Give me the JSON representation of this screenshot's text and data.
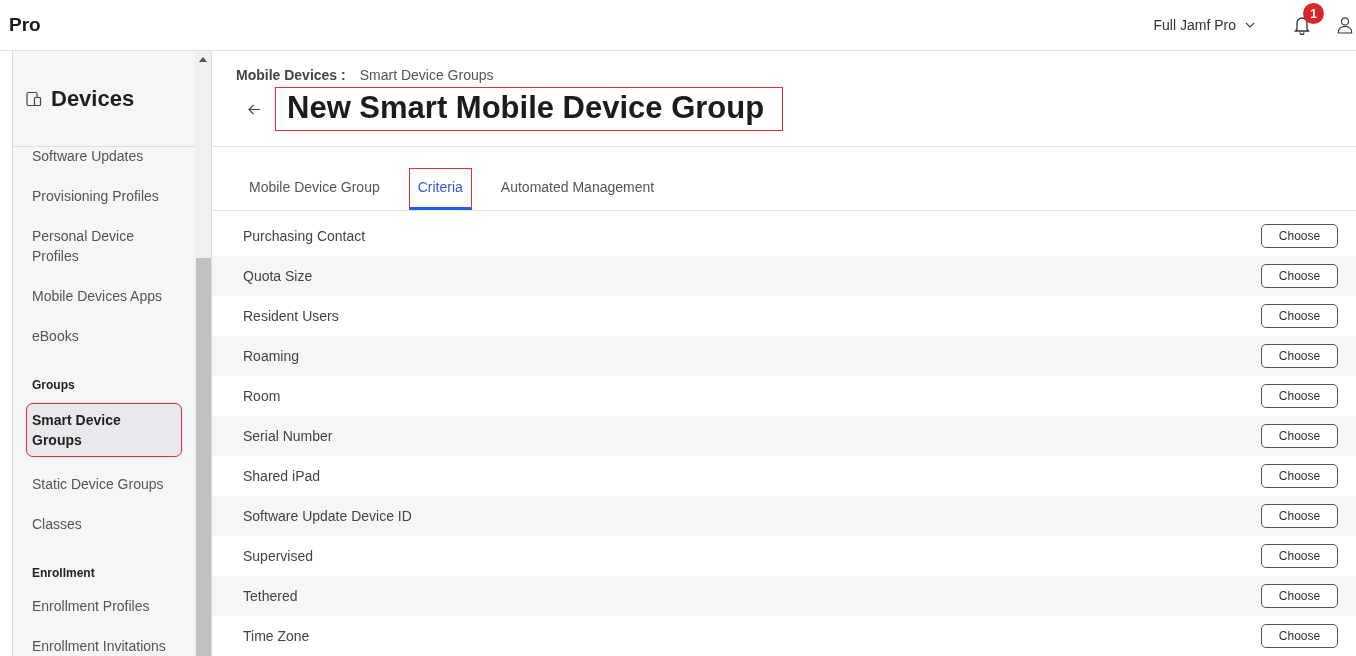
{
  "topbar": {
    "brand": "Pro",
    "environment": "Full Jamf Pro",
    "notification_count": "1"
  },
  "sidebar": {
    "title": "Devices",
    "items": [
      {
        "kind": "item",
        "label": "Software Updates",
        "selected": false,
        "annotated": false
      },
      {
        "kind": "item",
        "label": "Provisioning Profiles",
        "selected": false,
        "annotated": false
      },
      {
        "kind": "item",
        "label": "Personal Device Profiles",
        "selected": false,
        "annotated": false
      },
      {
        "kind": "item",
        "label": "Mobile Devices Apps",
        "selected": false,
        "annotated": false
      },
      {
        "kind": "item",
        "label": "eBooks",
        "selected": false,
        "annotated": false
      },
      {
        "kind": "section",
        "label": "Groups"
      },
      {
        "kind": "item",
        "label": "Smart Device Groups",
        "selected": true,
        "annotated": true
      },
      {
        "kind": "item",
        "label": "Static Device Groups",
        "selected": false,
        "annotated": false
      },
      {
        "kind": "item",
        "label": "Classes",
        "selected": false,
        "annotated": false
      },
      {
        "kind": "section",
        "label": "Enrollment"
      },
      {
        "kind": "item",
        "label": "Enrollment Profiles",
        "selected": false,
        "annotated": false
      },
      {
        "kind": "item",
        "label": "Enrollment Invitations",
        "selected": false,
        "annotated": false
      }
    ]
  },
  "breadcrumb": {
    "parent": "Mobile Devices :",
    "current": "Smart Device Groups"
  },
  "page_title": {
    "text": "New Smart Mobile Device Group",
    "annotated": true
  },
  "tabs": [
    {
      "label": "Mobile Device Group",
      "selected": false,
      "annotated": false
    },
    {
      "label": "Criteria",
      "selected": true,
      "annotated": true
    },
    {
      "label": "Automated Management",
      "selected": false,
      "annotated": false
    }
  ],
  "criteria": [
    {
      "name": "Purchasing Contact",
      "action": "Choose"
    },
    {
      "name": "Quota Size",
      "action": "Choose"
    },
    {
      "name": "Resident Users",
      "action": "Choose"
    },
    {
      "name": "Roaming",
      "action": "Choose"
    },
    {
      "name": "Room",
      "action": "Choose"
    },
    {
      "name": "Serial Number",
      "action": "Choose"
    },
    {
      "name": "Shared iPad",
      "action": "Choose"
    },
    {
      "name": "Software Update Device ID",
      "action": "Choose"
    },
    {
      "name": "Supervised",
      "action": "Choose"
    },
    {
      "name": "Tethered",
      "action": "Choose"
    },
    {
      "name": "Time Zone",
      "action": "Choose"
    }
  ]
}
